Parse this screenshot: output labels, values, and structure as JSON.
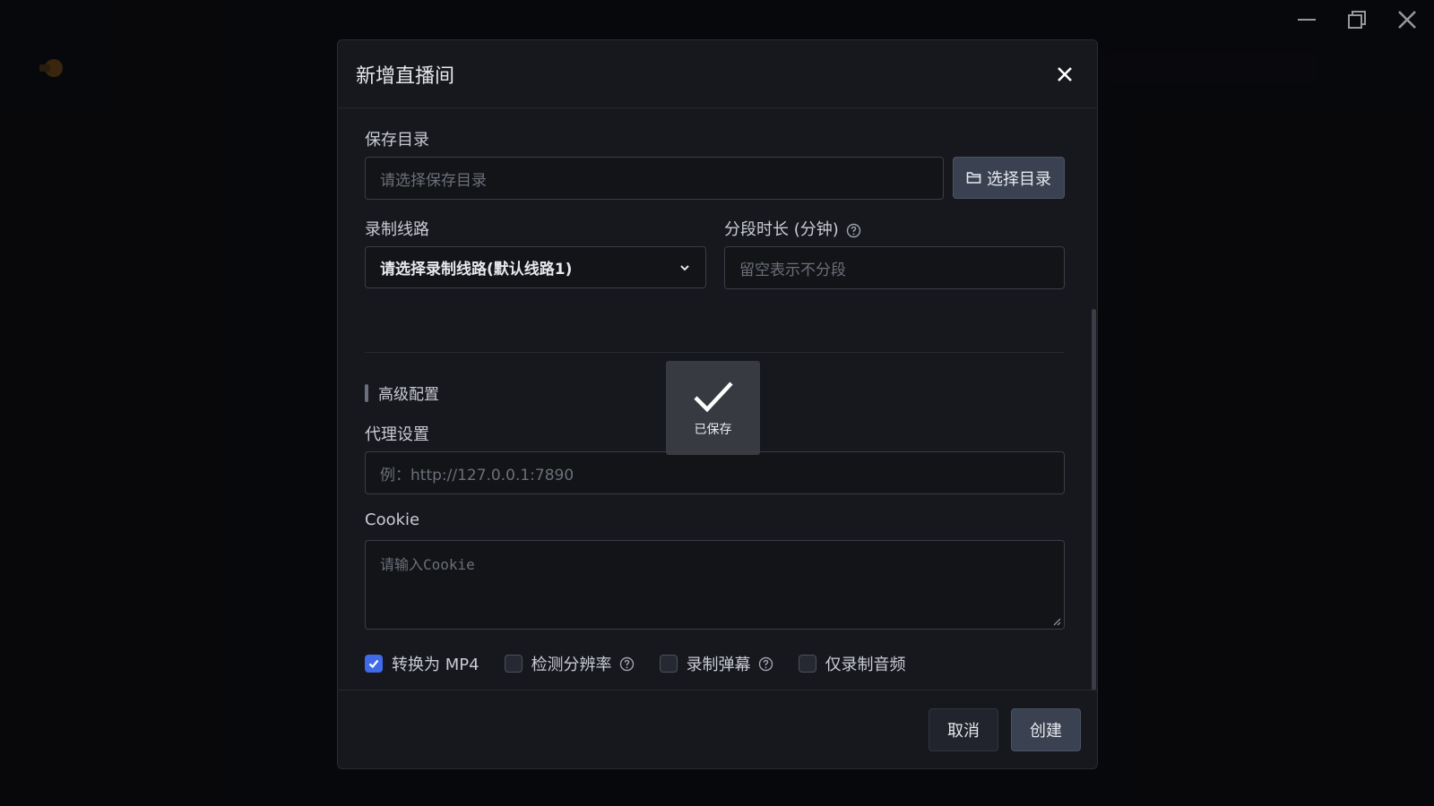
{
  "window": {
    "controls": [
      "minimize",
      "maximize",
      "close"
    ]
  },
  "dialog": {
    "title": "新增直播间",
    "save_dir": {
      "label": "保存目录",
      "placeholder": "请选择保存目录",
      "button_label": "选择目录"
    },
    "line": {
      "label": "录制线路",
      "selected": "请选择录制线路(默认线路1)"
    },
    "segment": {
      "label": "分段时长 (分钟)",
      "placeholder": "留空表示不分段"
    },
    "advanced_title": "高级配置",
    "proxy": {
      "label": "代理设置",
      "placeholder": "例：http://127.0.0.1:7890"
    },
    "cookie": {
      "label": "Cookie",
      "placeholder": "请输入Cookie"
    },
    "options": [
      {
        "label": "转换为 MP4",
        "checked": true,
        "help": false
      },
      {
        "label": "检测分辨率",
        "checked": false,
        "help": true
      },
      {
        "label": "录制弹幕",
        "checked": false,
        "help": true
      },
      {
        "label": "仅录制音频",
        "checked": false,
        "help": false
      }
    ],
    "cancel_label": "取消",
    "create_label": "创建"
  },
  "toast": {
    "text": "已保存"
  },
  "colors": {
    "accent": "#3f6ae8",
    "primary_button": "#3a4252",
    "dialog_bg": "#17181d"
  }
}
